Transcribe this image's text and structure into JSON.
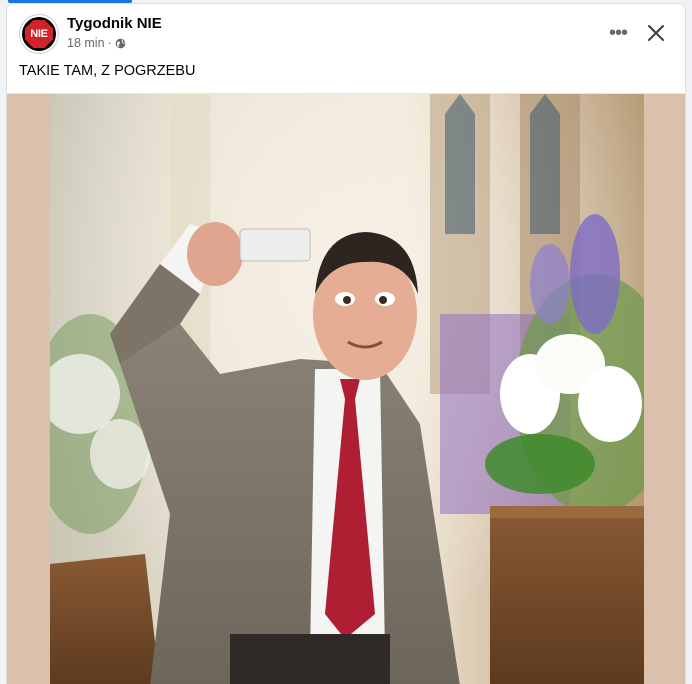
{
  "post": {
    "author": "Tygodnik NIE",
    "avatar_text": "NIE",
    "time": "18 min",
    "separator": "·",
    "privacy_icon": "globe-icon",
    "text": "TAKIE TAM, Z POGRZEBU"
  },
  "actions": {
    "more_label": "•••",
    "more_icon": "more-options-icon",
    "close_icon": "close-icon"
  },
  "colors": {
    "accent": "#1b74e4",
    "text_primary": "#050505",
    "text_secondary": "#65676b",
    "media_background": "#dbc1ab"
  }
}
